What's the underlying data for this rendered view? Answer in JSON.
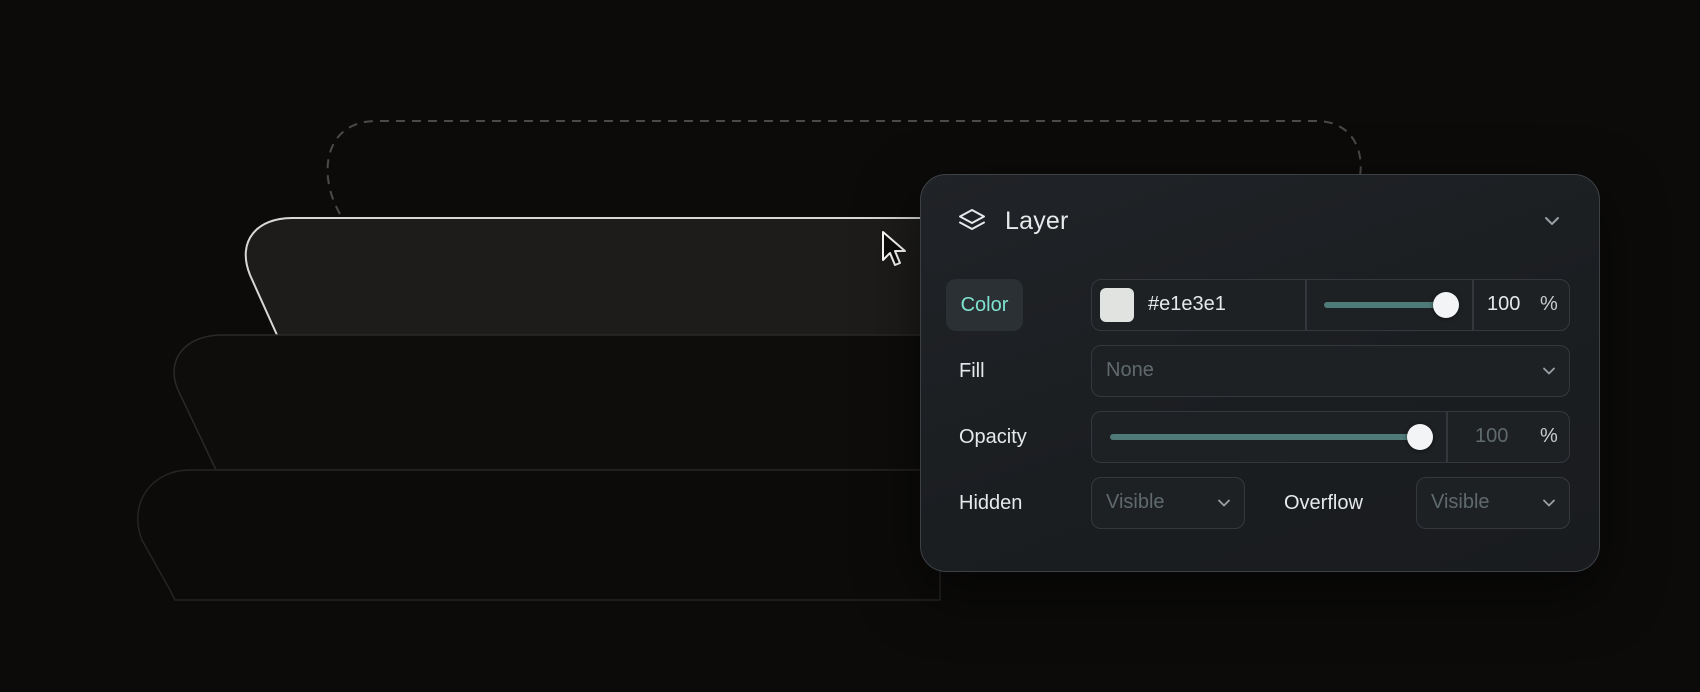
{
  "panel": {
    "title": "Layer",
    "icon": "layers-icon",
    "collapse_icon": "chevron-down-icon"
  },
  "color_row": {
    "label": "Color",
    "hex": "#e1e3e1",
    "swatch_color": "#e1e3e1",
    "opacity_value": "100",
    "opacity_unit": "%",
    "slider_level": 1.0
  },
  "fill_row": {
    "label": "Fill",
    "value": "None"
  },
  "opacity_row": {
    "label": "Opacity",
    "value": "100",
    "unit": "%",
    "slider_level": 1.0
  },
  "hidden_row": {
    "label": "Hidden",
    "value": "Visible"
  },
  "overflow_row": {
    "label": "Overflow",
    "value": "Visible"
  },
  "colors": {
    "accent": "#7fe3d0",
    "slider": "#4e7a78",
    "background": "#0c0b0a"
  }
}
